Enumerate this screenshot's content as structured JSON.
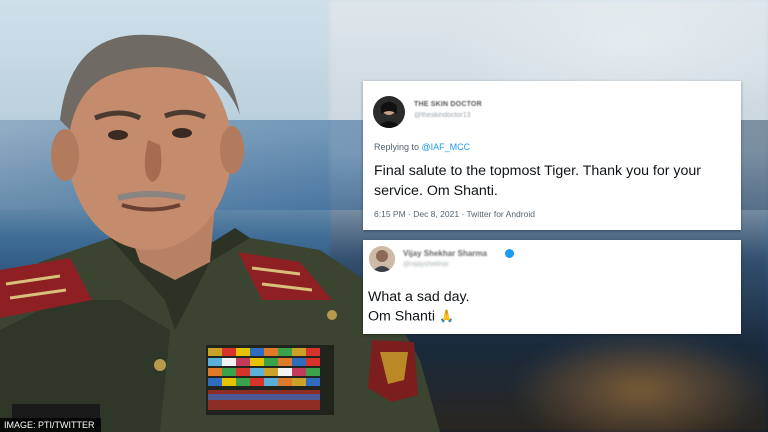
{
  "caption": "IMAGE: PTI/TWITTER",
  "tweet1": {
    "display_name": "THE SKIN DOCTOR",
    "handle": "@theskindoctor13",
    "replying_prefix": "Replying to ",
    "replying_mention": "@IAF_MCC",
    "text": "Final salute to the topmost Tiger. Thank you for your service. Om Shanti.",
    "meta": "6:15 PM · Dec 8, 2021 · Twitter for Android"
  },
  "tweet2": {
    "display_name": "Vijay Shekhar Sharma",
    "handle": "@vijayshekhar",
    "line1": "What a sad day.",
    "line2": "Om Shanti",
    "emoji": "🙏"
  },
  "colors": {
    "link": "#1d9bf0",
    "verified": "#1d9bf0",
    "text": "#0f1419",
    "muted": "#536471"
  },
  "icons": {
    "avatar1": "avatar-icon",
    "avatar2": "avatar-icon",
    "verified": "verified-badge-icon",
    "emoji": "folded-hands-emoji"
  }
}
